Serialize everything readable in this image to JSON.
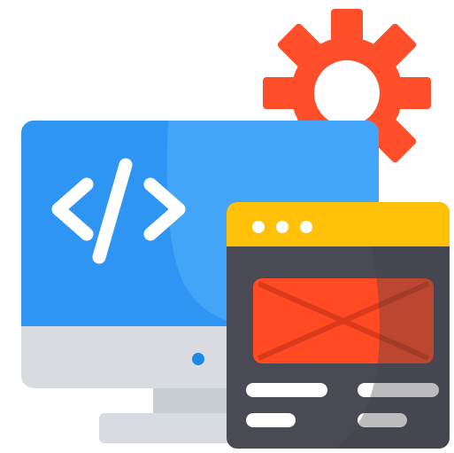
{
  "illustration": {
    "icons": [
      "gear-icon",
      "desktop-monitor-icon",
      "code-brackets-icon",
      "browser-window-icon"
    ],
    "colors": {
      "gear": "#FF4E2A",
      "monitor_screen": "#2F95F2",
      "monitor_screen_highlight": "#5AB7FF",
      "monitor_chin": "#D8DCE2",
      "monitor_stand": "#C8CDD4",
      "power_led": "#1E88E5",
      "code_glyph": "#FFFFFF",
      "browser_titlebar": "#FFC107",
      "browser_body": "#4A4A55",
      "browser_hero": "#FF4A24",
      "browser_text_lines": "#FFFFFF"
    },
    "browser_titlebar_dots": 3
  }
}
